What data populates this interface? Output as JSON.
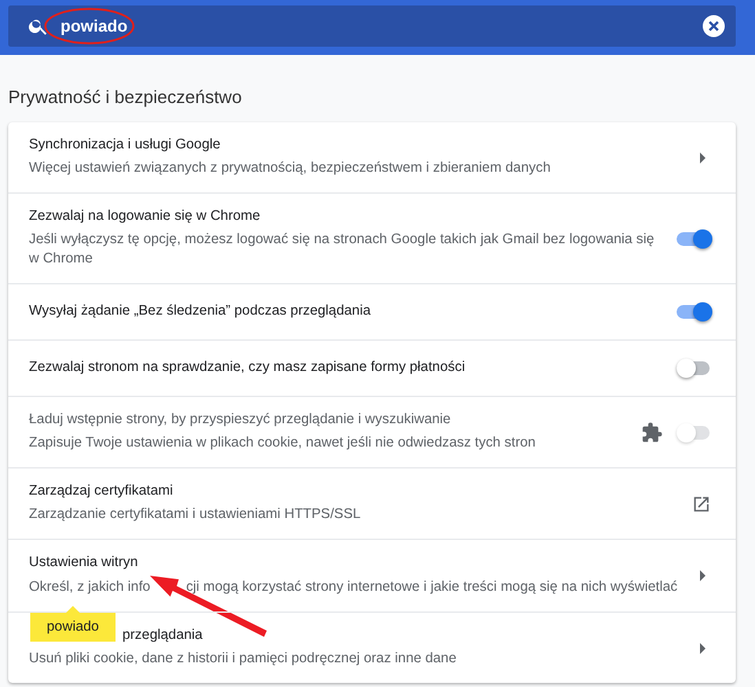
{
  "search": {
    "value": "powiado",
    "highlighted": true
  },
  "section_title": "Prywatność i bezpieczeństwo",
  "rows": [
    {
      "kind": "arrow",
      "title": "Synchronizacja i usługi Google",
      "subtitle": [
        "Więcej ustawień związanych z prywatnością, bezpieczeństwem i zbieraniem danych"
      ],
      "extension_icon": false,
      "disabled": false
    },
    {
      "kind": "toggle",
      "title": "Zezwalaj na logowanie się w Chrome",
      "subtitle": [
        "Jeśli wyłączysz tę opcję, możesz logować się na stronach Google takich jak Gmail bez logowania się w Chrome"
      ],
      "on": true,
      "extension_icon": false,
      "disabled": false
    },
    {
      "kind": "toggle",
      "title": "Wysyłaj żądanie „Bez śledzenia” podczas przeglądania",
      "on": true,
      "extension_icon": false,
      "disabled": false
    },
    {
      "kind": "toggle",
      "title": "Zezwalaj stronom na sprawdzanie, czy masz zapisane formy płatności",
      "on": false,
      "extension_icon": false,
      "disabled": false
    },
    {
      "kind": "toggle",
      "title": "Ładuj wstępnie strony, by przyspieszyć przeglądanie i wyszukiwanie",
      "subtitle": [
        "Zapisuje Twoje ustawienia w plikach cookie, nawet jeśli nie odwiedzasz tych stron"
      ],
      "on": false,
      "extension_icon": true,
      "disabled": true
    },
    {
      "kind": "external",
      "title": "Zarządzaj certyfikatami",
      "subtitle": [
        "Zarządzanie certyfikatami i ustawieniami HTTPS/SSL"
      ],
      "extension_icon": false,
      "disabled": false
    },
    {
      "kind": "arrow",
      "title": "Ustawienia witryn",
      "subtitle": [
        "Określ, z jakich info",
        "cji mogą korzystać strony internetowe i jakie treści mogą się na nich wyświetlać"
      ],
      "extension_icon": false,
      "disabled": false,
      "annotation_arrow": true
    },
    {
      "kind": "arrow",
      "title": "przeglądania",
      "subtitle": [
        "Usuń pliki cookie, dane z historii i pamięci podręcznej oraz inne dane"
      ],
      "extension_icon": false,
      "disabled": false,
      "tooltip": "powiado"
    }
  ]
}
